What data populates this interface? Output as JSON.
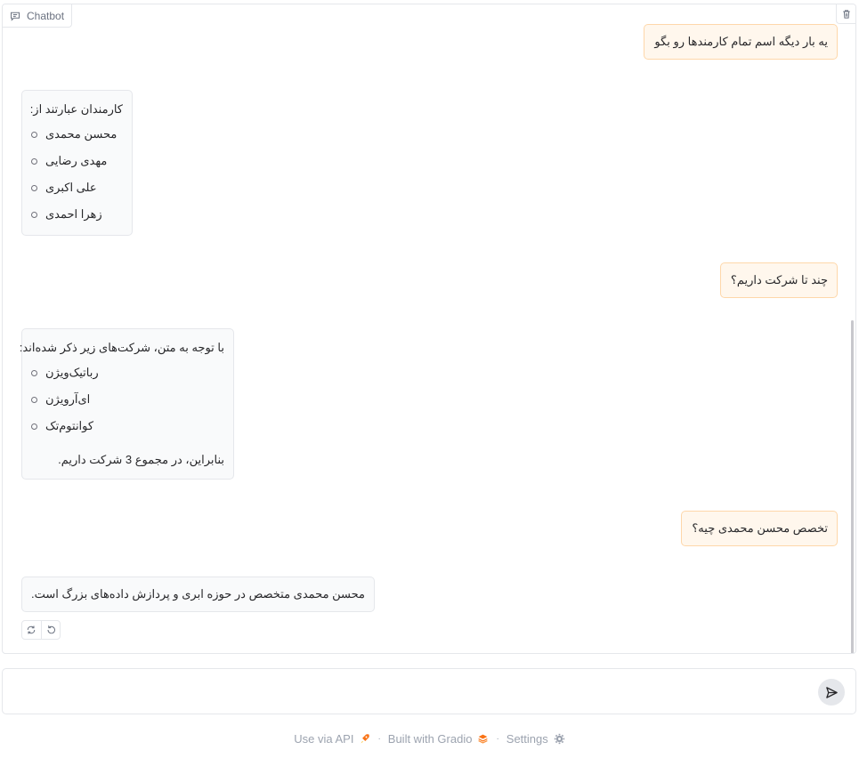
{
  "chatbot": {
    "label": "Chatbot",
    "messages": [
      {
        "role": "user",
        "text": "یه بار دیگه اسم تمام کارمندها رو بگو"
      },
      {
        "role": "assistant",
        "intro": "کارمندان عبارتند از:",
        "items": [
          "محسن محمدی",
          "مهدی رضایی",
          "علی اکبری",
          "زهرا احمدی"
        ]
      },
      {
        "role": "user",
        "text": "چند تا شرکت داریم؟"
      },
      {
        "role": "assistant",
        "intro": "با توجه به متن، شرکت‌های زیر ذکر شده‌اند:",
        "items": [
          "رباتیک‌ویژن",
          "ای‌آرویژن",
          "کوانتوم‌تک"
        ],
        "outro": "بنابراین، در مجموع 3 شرکت داریم."
      },
      {
        "role": "user",
        "text": "تخصص محسن محمدی چیه؟"
      },
      {
        "role": "assistant",
        "text": "محسن محمدی متخصص در حوزه ابری و پردازش داده‌های بزرگ است."
      }
    ]
  },
  "input": {
    "value": "",
    "placeholder": ""
  },
  "footer": {
    "api": "Use via API",
    "built": "Built with Gradio",
    "settings": "Settings",
    "separator": "·"
  },
  "colors": {
    "user_bubble": "#fff7ed",
    "user_border": "#fed7aa",
    "bot_bubble": "#f9fafb"
  }
}
